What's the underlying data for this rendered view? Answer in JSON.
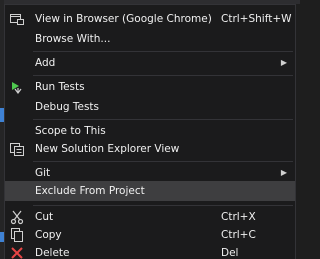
{
  "menu": {
    "items": [
      {
        "label": "View in Browser (Google Chrome)",
        "shortcut": "Ctrl+Shift+W",
        "icon": "browser-view-icon"
      },
      {
        "label": "Browse With..."
      },
      {
        "label": "Add",
        "submenu": true
      },
      {
        "label": "Run Tests",
        "icon": "run-tests-icon"
      },
      {
        "label": "Debug Tests"
      },
      {
        "label": "Scope to This"
      },
      {
        "label": "New Solution Explorer View",
        "icon": "solution-explorer-icon"
      },
      {
        "label": "Git",
        "submenu": true
      },
      {
        "label": "Exclude From Project",
        "highlighted": true
      },
      {
        "label": "Cut",
        "shortcut": "Ctrl+X",
        "icon": "scissors-icon"
      },
      {
        "label": "Copy",
        "shortcut": "Ctrl+C",
        "icon": "copy-icon"
      },
      {
        "label": "Delete",
        "shortcut": "Del",
        "icon": "delete-x-icon"
      }
    ]
  },
  "colors": {
    "menu_bg": "#1b1b1c",
    "hover_bg": "#3e3e40",
    "text": "#f1f1f1",
    "separator": "#333337",
    "test_icon_green": "#4fc94f",
    "delete_red": "#e84545"
  }
}
